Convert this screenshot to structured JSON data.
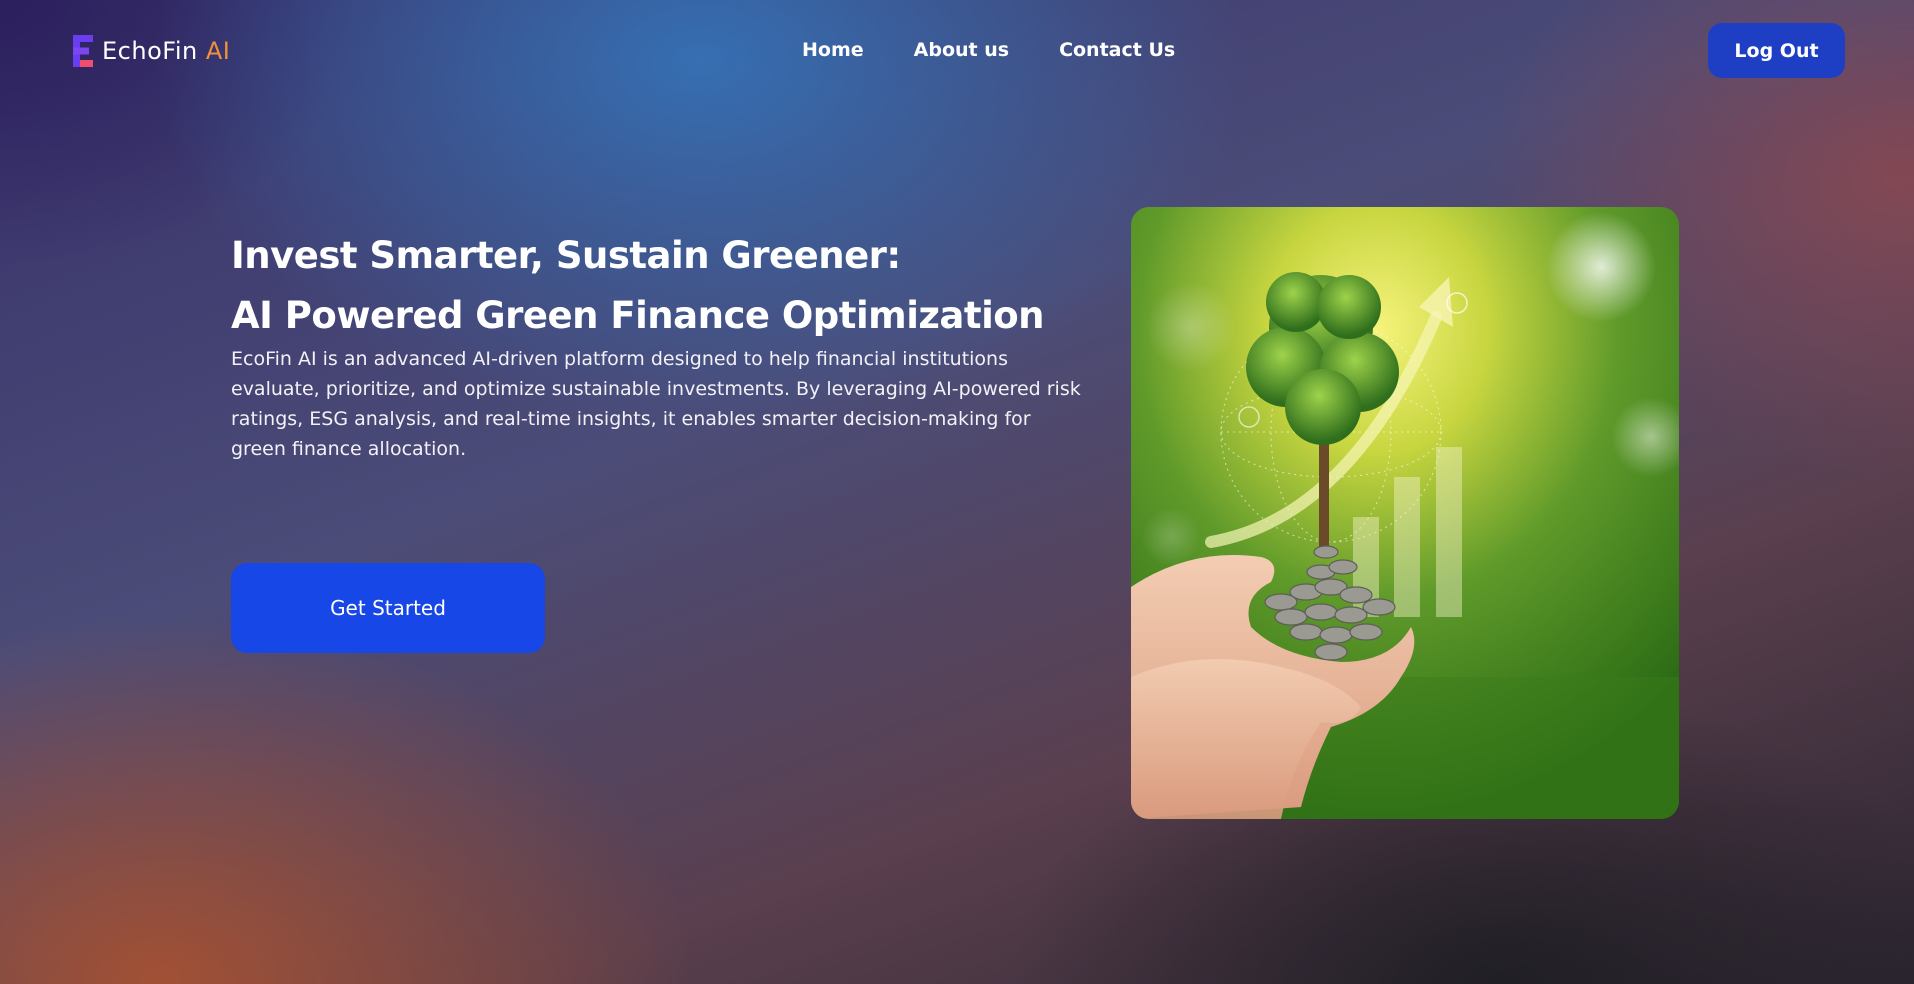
{
  "brand": {
    "name": "EchoFin",
    "accent": "AI",
    "accent_color": "#f0913a",
    "logo_icon": "letter-e-logo-icon"
  },
  "nav": {
    "links": [
      {
        "label": "Home"
      },
      {
        "label": "About us"
      },
      {
        "label": "Contact Us"
      }
    ],
    "logout_label": "Log Out"
  },
  "hero": {
    "title_line1": "Invest Smarter, Sustain Greener:",
    "title_line2": "AI Powered Green Finance Optimization",
    "description": "EcoFin AI is an advanced AI-driven platform designed to help financial institutions evaluate, prioritize, and optimize sustainable investments. By leveraging AI-powered risk ratings, ESG analysis, and real-time insights, it enables smarter decision-making for green finance allocation.",
    "cta_label": "Get Started"
  },
  "colors": {
    "primary_button": "#1747e6",
    "logout_button": "#1e3fc4"
  }
}
